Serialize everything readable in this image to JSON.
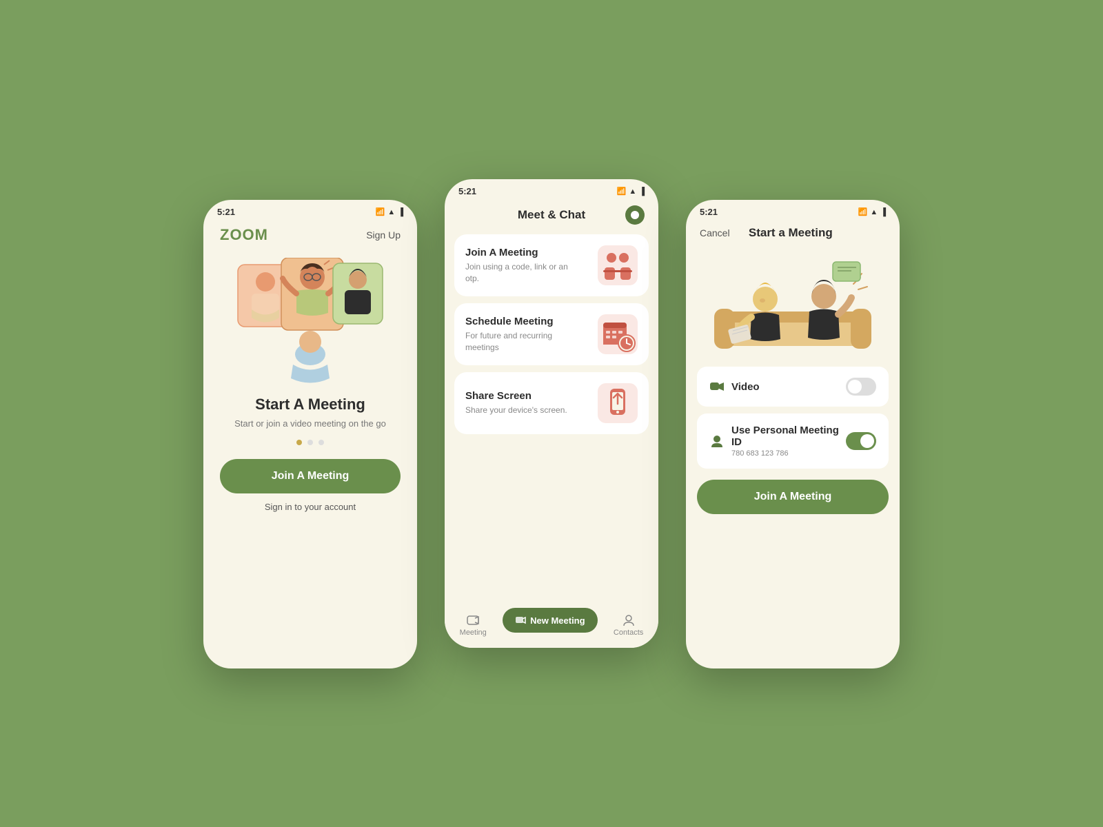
{
  "background": "#7a9e5e",
  "phone1": {
    "status_time": "5:21",
    "logo": "ZOOM",
    "signup_label": "Sign Up",
    "title": "Start A Meeting",
    "subtitle": "Start or join a video meeting on the go",
    "join_button": "Join A Meeting",
    "signin_link": "Sign in to your account"
  },
  "phone2": {
    "status_time": "5:21",
    "header_title": "Meet & Chat",
    "cards": [
      {
        "title": "Join A Meeting",
        "description": "Join using a code, link or an otp.",
        "icon": "people-meeting"
      },
      {
        "title": "Schedule Meeting",
        "description": "For future and recurring meetings",
        "icon": "calendar-clock"
      },
      {
        "title": "Share Screen",
        "description": "Share your device's screen.",
        "icon": "screen-share"
      }
    ],
    "new_meeting_button": "New Meeting",
    "nav_meeting": "Meeting",
    "nav_contacts": "Contacts"
  },
  "phone3": {
    "status_time": "5:21",
    "cancel_label": "Cancel",
    "title": "Start a Meeting",
    "video_label": "Video",
    "video_enabled": false,
    "personal_id_label": "Use Personal Meeting ID",
    "personal_id": "780 683 123 786",
    "personal_id_enabled": true,
    "join_button": "Join A Meeting"
  }
}
